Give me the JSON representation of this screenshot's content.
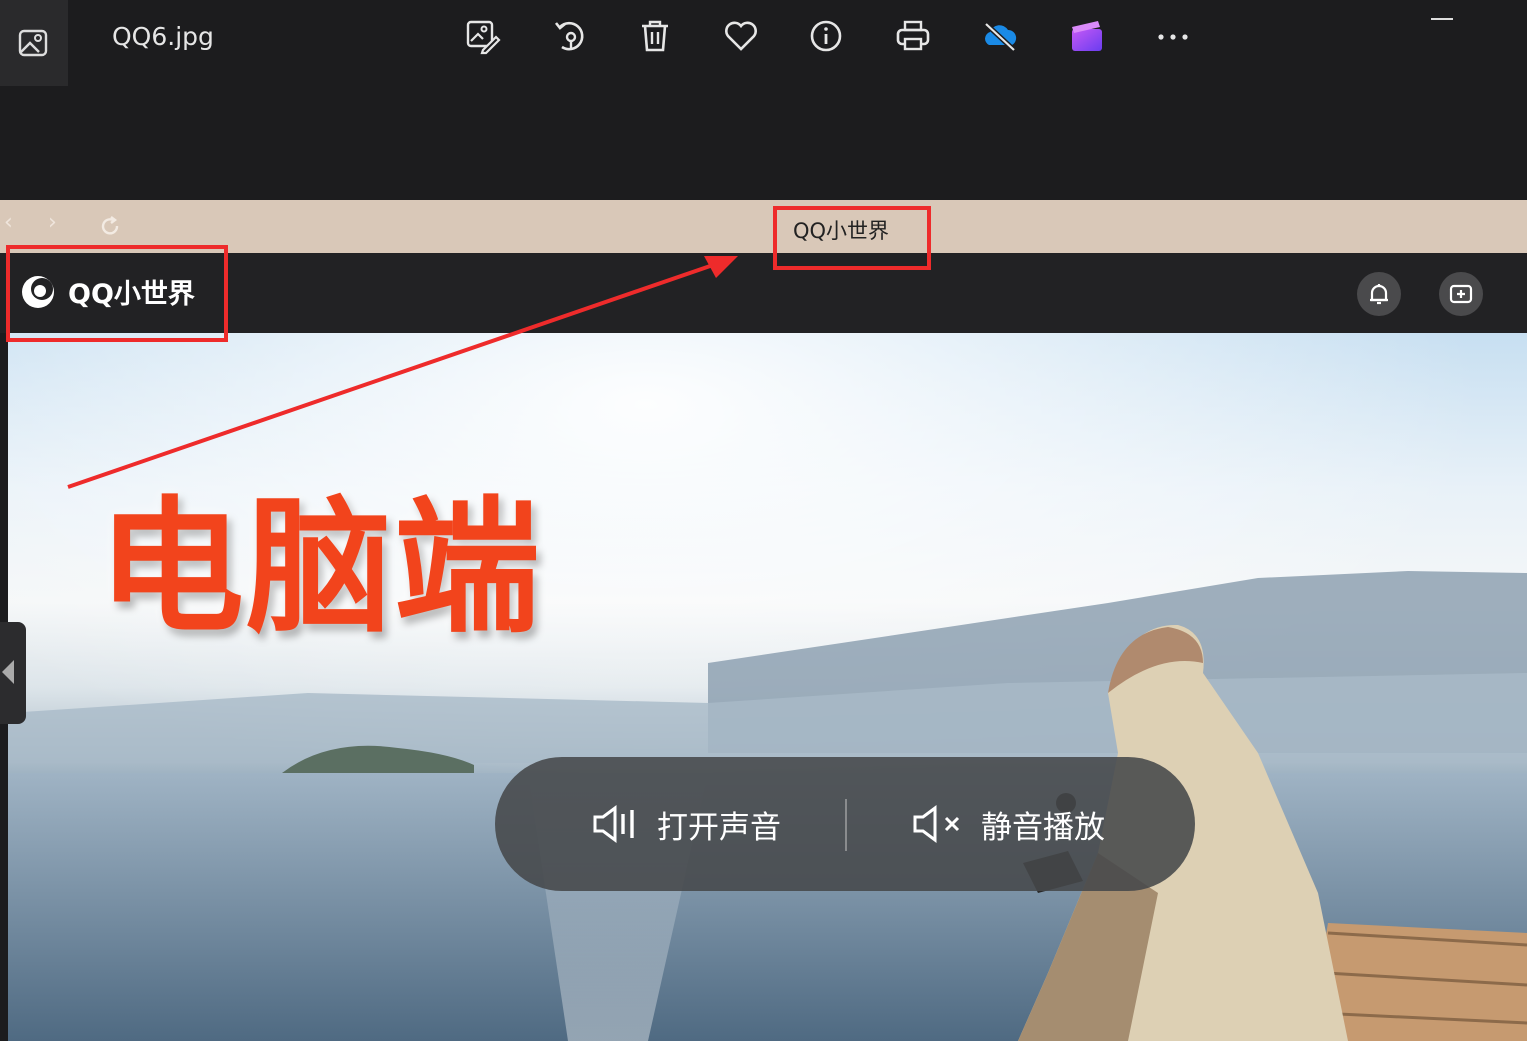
{
  "viewer": {
    "file_name": "QQ6.jpg",
    "toolbar_icons": [
      "edit-image-icon",
      "rotate-icon",
      "delete-icon",
      "favorite-icon",
      "info-icon",
      "print-icon",
      "onedrive-icon",
      "clipchamp-icon",
      "more-icon"
    ]
  },
  "browser": {
    "tab_title": "QQ小世界",
    "nav_icons": [
      "back-icon",
      "forward-icon",
      "reload-icon"
    ]
  },
  "app": {
    "logo_text": "QQ小世界",
    "header_icons": [
      "bell-icon",
      "add-video-icon"
    ]
  },
  "overlay": {
    "label": "电脑端",
    "color": "#f2441c"
  },
  "sound_prompt": {
    "unmute_label": "打开声音",
    "mute_label": "静音播放"
  },
  "annotation_color": "#ee2b2b"
}
